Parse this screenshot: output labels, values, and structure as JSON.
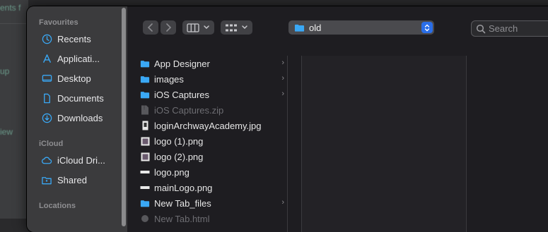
{
  "background": {
    "hint_1": "ents f",
    "hint_2": "up",
    "hint_3": "iew"
  },
  "sidebar": {
    "sections": [
      {
        "label": "Favourites"
      },
      {
        "label": "iCloud"
      },
      {
        "label": "Locations"
      }
    ],
    "favourites": [
      {
        "label": "Recents",
        "icon": "clock-icon"
      },
      {
        "label": "Applicati...",
        "icon": "applications-icon"
      },
      {
        "label": "Desktop",
        "icon": "desktop-icon"
      },
      {
        "label": "Documents",
        "icon": "document-icon"
      },
      {
        "label": "Downloads",
        "icon": "download-icon"
      }
    ],
    "icloud": [
      {
        "label": "iCloud Dri...",
        "icon": "cloud-icon"
      },
      {
        "label": "Shared",
        "icon": "shared-folder-icon"
      }
    ]
  },
  "toolbar": {
    "location": "old",
    "search_placeholder": "Search"
  },
  "files": [
    {
      "name": "App Designer",
      "kind": "folder",
      "has_children": true,
      "dimmed": false
    },
    {
      "name": "images",
      "kind": "folder",
      "has_children": true,
      "dimmed": false
    },
    {
      "name": "iOS Captures",
      "kind": "folder",
      "has_children": true,
      "dimmed": false
    },
    {
      "name": "iOS Captures.zip",
      "kind": "zip",
      "has_children": false,
      "dimmed": true
    },
    {
      "name": "loginArchwayAcademy.jpg",
      "kind": "image-tall",
      "has_children": false,
      "dimmed": false
    },
    {
      "name": "logo (1).png",
      "kind": "image",
      "has_children": false,
      "dimmed": false
    },
    {
      "name": "logo (2).png",
      "kind": "image",
      "has_children": false,
      "dimmed": false
    },
    {
      "name": "logo.png",
      "kind": "image-wide",
      "has_children": false,
      "dimmed": false
    },
    {
      "name": "mainLogo.png",
      "kind": "image-wide",
      "has_children": false,
      "dimmed": false
    },
    {
      "name": "New Tab_files",
      "kind": "folder",
      "has_children": true,
      "dimmed": false
    },
    {
      "name": "New Tab.html",
      "kind": "html",
      "has_children": false,
      "dimmed": true
    }
  ],
  "colors": {
    "accent": "#2a6ee8",
    "folder": "#3aa8f5"
  }
}
